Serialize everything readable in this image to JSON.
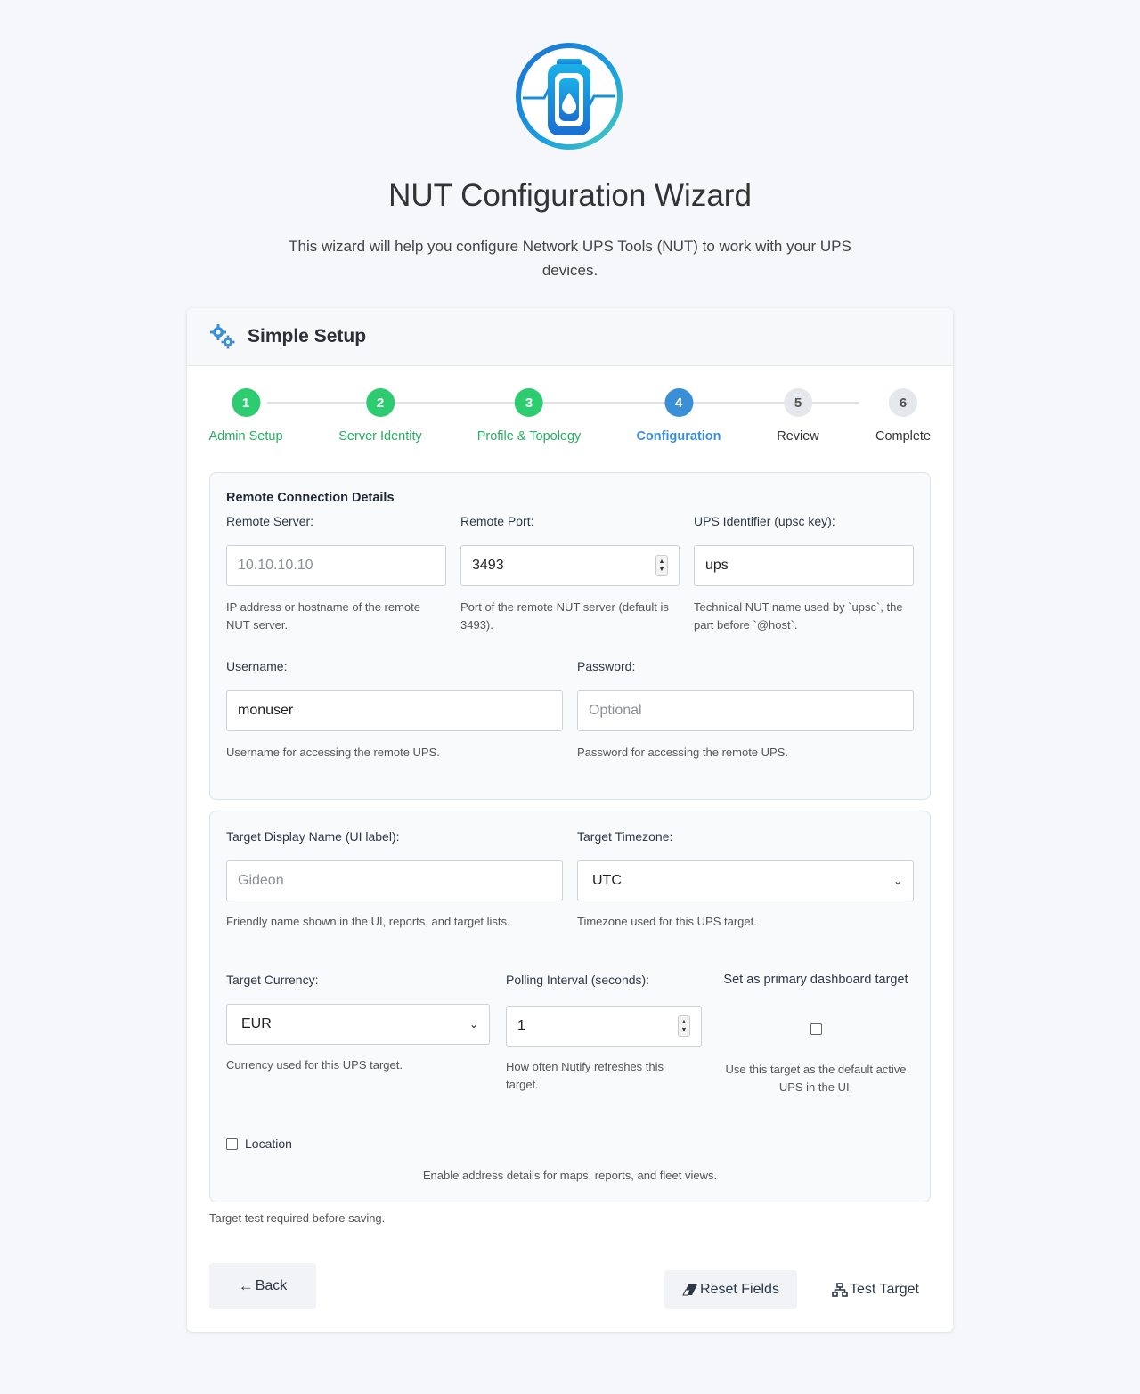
{
  "header": {
    "title": "NUT Configuration Wizard",
    "subtitle": "This wizard will help you configure Network UPS Tools (NUT) to work with your UPS devices."
  },
  "card": {
    "title": "Simple Setup"
  },
  "steps": [
    {
      "num": "1",
      "label": "Admin Setup",
      "state": "done"
    },
    {
      "num": "2",
      "label": "Server Identity",
      "state": "done"
    },
    {
      "num": "3",
      "label": "Profile & Topology",
      "state": "done"
    },
    {
      "num": "4",
      "label": "Configuration",
      "state": "active"
    },
    {
      "num": "5",
      "label": "Review",
      "state": "todo"
    },
    {
      "num": "6",
      "label": "Complete",
      "state": "todo"
    }
  ],
  "remote": {
    "title": "Remote Connection Details",
    "server": {
      "label": "Remote Server:",
      "placeholder": "10.10.10.10",
      "hint": "IP address or hostname of the remote NUT server."
    },
    "port": {
      "label": "Remote Port:",
      "value": "3493",
      "hint": "Port of the remote NUT server (default is 3493)."
    },
    "ups_id": {
      "label": "UPS Identifier (upsc key):",
      "value": "ups",
      "hint": "Technical NUT name used by `upsc`, the part before `@host`."
    },
    "username": {
      "label": "Username:",
      "value": "monuser",
      "hint": "Username for accessing the remote UPS."
    },
    "password": {
      "label": "Password:",
      "placeholder": "Optional",
      "hint": "Password for accessing the remote UPS."
    }
  },
  "target": {
    "display_name": {
      "label": "Target Display Name (UI label):",
      "placeholder": "Gideon",
      "hint": "Friendly name shown in the UI, reports, and target lists."
    },
    "timezone": {
      "label": "Target Timezone:",
      "value": "UTC",
      "hint": "Timezone used for this UPS target."
    },
    "currency": {
      "label": "Target Currency:",
      "value": "EUR",
      "hint": "Currency used for this UPS target."
    },
    "polling": {
      "label": "Polling Interval (seconds):",
      "value": "1",
      "hint": "How often Nutify refreshes this target."
    },
    "primary": {
      "label": "Set as primary dashboard target",
      "hint": "Use this target as the default active UPS in the UI."
    },
    "location": {
      "label": "Location",
      "hint": "Enable address details for maps, reports, and fleet views."
    }
  },
  "note": "Target test required before saving.",
  "buttons": {
    "back": "Back",
    "reset": "Reset Fields",
    "test": "Test Target"
  },
  "colors": {
    "done": "#2ecc71",
    "active": "#3a8fd9",
    "todo": "#e4e7ec"
  }
}
